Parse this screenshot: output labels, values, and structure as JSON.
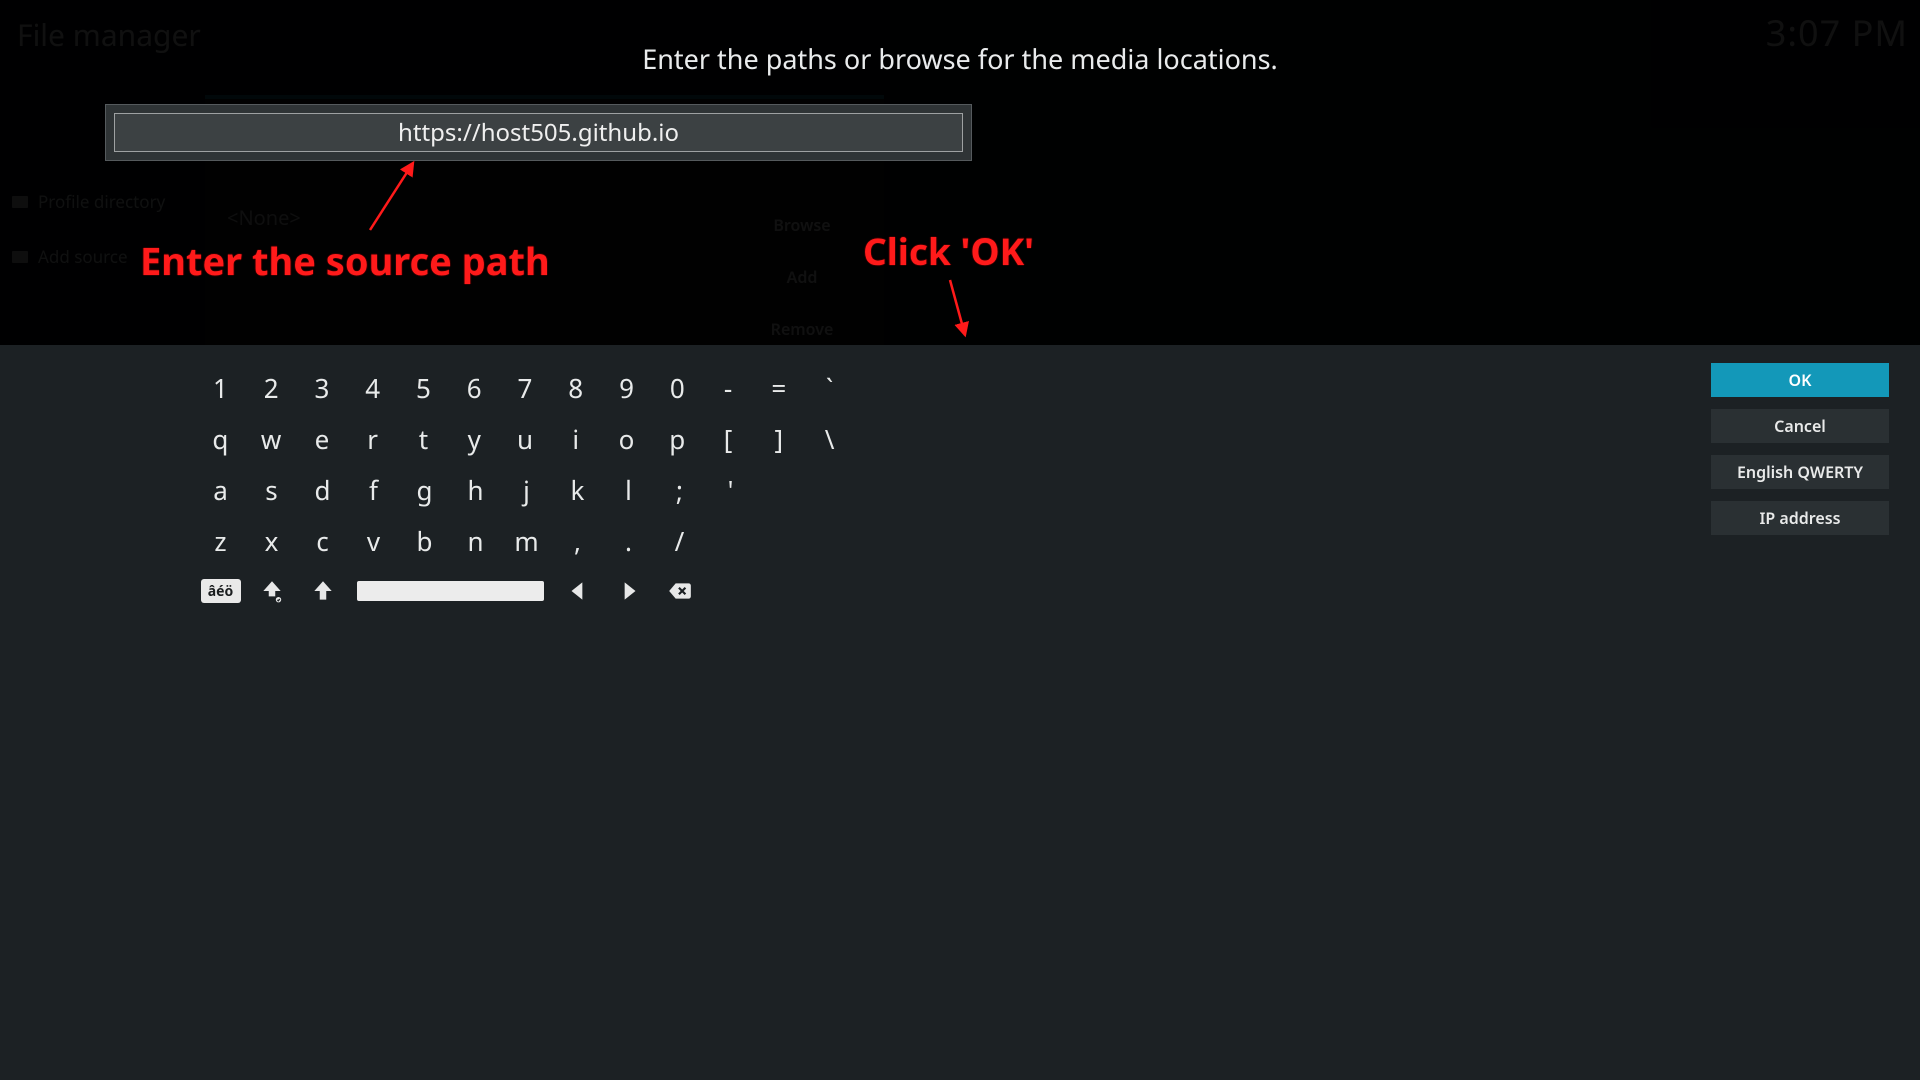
{
  "background": {
    "window_title": "File manager",
    "clock": "3:07 PM",
    "sidebar": [
      "Profile directory",
      "Add source"
    ],
    "panel": {
      "current_source": "<None>",
      "buttons": {
        "browse": "Browse",
        "add": "Add",
        "remove": "Remove"
      }
    }
  },
  "prompt": "Enter the paths or browse for the media locations.",
  "url_value": "https://host505.github.io",
  "annotations": {
    "enter_path": "Enter the source path",
    "click_ok": "Click 'OK'"
  },
  "keyboard": {
    "rows": [
      [
        "1",
        "2",
        "3",
        "4",
        "5",
        "6",
        "7",
        "8",
        "9",
        "0",
        "-",
        "=",
        "`"
      ],
      [
        "q",
        "w",
        "e",
        "r",
        "t",
        "y",
        "u",
        "i",
        "o",
        "p",
        "[",
        "]",
        "\\"
      ],
      [
        "a",
        "s",
        "d",
        "f",
        "g",
        "h",
        "j",
        "k",
        "l",
        ";",
        "'"
      ],
      [
        "z",
        "x",
        "c",
        "v",
        "b",
        "n",
        "m",
        ",",
        ".",
        "/"
      ]
    ],
    "accents_label": "âéö"
  },
  "action_buttons": {
    "ok": "OK",
    "cancel": "Cancel",
    "layout": "English QWERTY",
    "ip": "IP address"
  }
}
